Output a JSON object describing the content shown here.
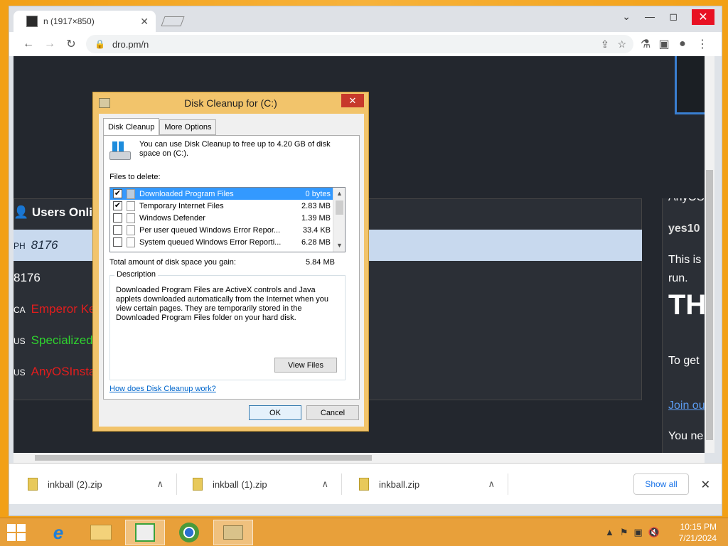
{
  "browser": {
    "tab_title": "n (1917×850)",
    "tab_close": "✕",
    "url": "dro.pm/n",
    "minimize": "—",
    "maximize": "◻",
    "close": "✕",
    "chevron": "⌄"
  },
  "page": {
    "users_title": "Users Onlin",
    "rows": [
      {
        "prefix": "PH",
        "name": "8176"
      },
      {
        "prefix": "",
        "name": "8176"
      },
      {
        "prefix": "CA",
        "name": "Emperor Ke"
      },
      {
        "prefix": "US",
        "name": "Specialized"
      },
      {
        "prefix": "US",
        "name": "AnyOSInsta"
      }
    ],
    "right_col": [
      "AnyOS",
      "yes10",
      "This is",
      "run.",
      "TH",
      "To get",
      "Join ou",
      "You ne"
    ]
  },
  "downloads": {
    "items": [
      {
        "name": "inkball (2).zip"
      },
      {
        "name": "inkball (1).zip"
      },
      {
        "name": "inkball.zip"
      }
    ],
    "show_all": "Show all",
    "close": "✕"
  },
  "dialog": {
    "title": "Disk Cleanup for  (C:)",
    "close": "✕",
    "tabs": [
      "Disk Cleanup",
      "More Options"
    ],
    "info": "You can use Disk Cleanup to free up to 4.20 GB of disk space on  (C:).",
    "files_label": "Files to delete:",
    "files": [
      {
        "checked": true,
        "name": "Downloaded Program Files",
        "size": "0 bytes"
      },
      {
        "checked": true,
        "name": "Temporary Internet Files",
        "size": "2.83 MB"
      },
      {
        "checked": false,
        "name": "Windows Defender",
        "size": "1.39 MB"
      },
      {
        "checked": false,
        "name": "Per user queued Windows Error Repor...",
        "size": "33.4 KB"
      },
      {
        "checked": false,
        "name": "System queued Windows Error Reporti...",
        "size": "6.28 MB"
      }
    ],
    "total_label": "Total amount of disk space you gain:",
    "total_value": "5.84 MB",
    "description_legend": "Description",
    "description": "Downloaded Program Files are ActiveX controls and Java applets downloaded automatically from the Internet when you view certain pages. They are temporarily stored in the Downloaded Program Files folder on your hard disk.",
    "view_files": "View Files",
    "help_link": "How does Disk Cleanup work?",
    "ok": "OK",
    "cancel": "Cancel"
  },
  "taskbar": {
    "time": "10:15 PM",
    "date": "7/21/2024"
  },
  "colors": {
    "accent": "#3399ff",
    "red_text": "#e21d1d",
    "green_text": "#2fd32f",
    "dialog_frame": "#f2c46b"
  }
}
